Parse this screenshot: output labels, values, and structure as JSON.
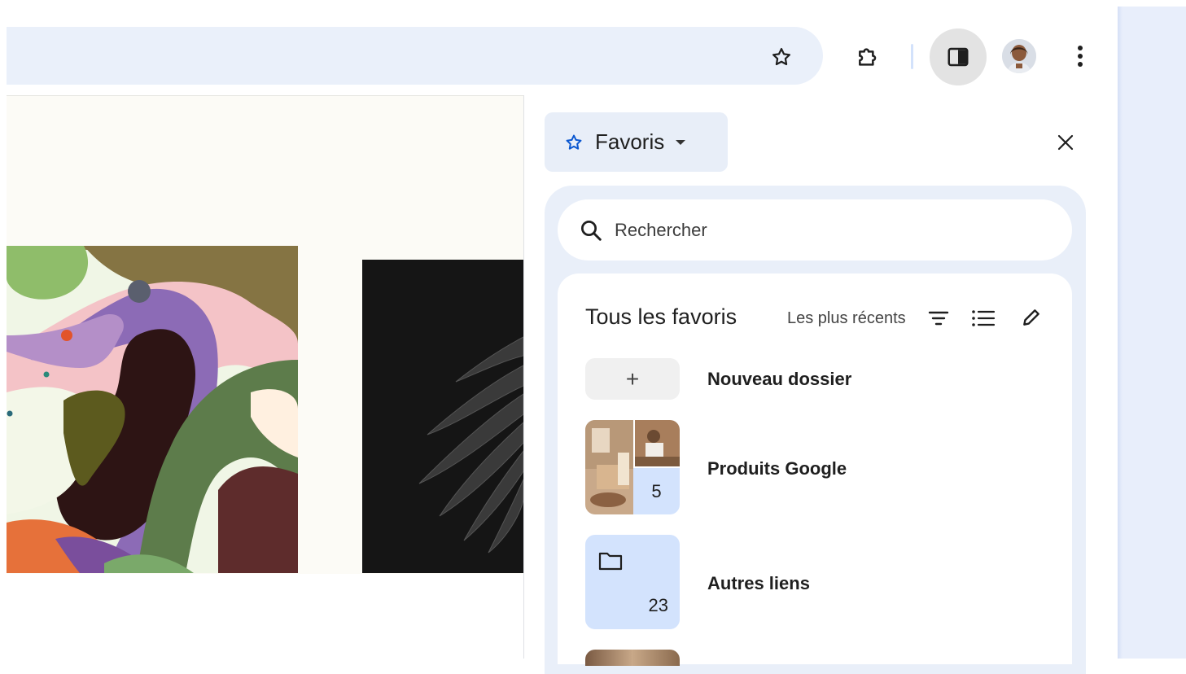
{
  "toolbar": {
    "bookmark_star_icon": "star-outline-icon",
    "extensions_icon": "puzzle-icon",
    "side_panel_icon": "side-panel-icon",
    "menu_icon": "more-vert-icon"
  },
  "side_panel": {
    "selector_label": "Favoris",
    "search_placeholder": "Rechercher",
    "section_title": "Tous les favoris",
    "sort_label": "Les plus récents",
    "items": [
      {
        "label": "Nouveau dossier",
        "action": "+"
      },
      {
        "label": "Produits Google",
        "count": "5"
      },
      {
        "label": "Autres liens",
        "count": "23"
      }
    ]
  },
  "colors": {
    "accent_blue": "#0b57d0",
    "tile_blue": "#d3e3fd",
    "panel_bg": "#e9eff9"
  }
}
